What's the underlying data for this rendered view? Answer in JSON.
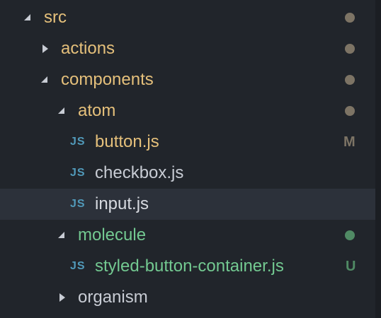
{
  "colors": {
    "background": "#21252b",
    "selected_row": "#2c313a",
    "modified": "#e5c07b",
    "untracked": "#73c991",
    "unchanged": "#c8ccd4",
    "dot_modified": "#7d7465",
    "dot_untracked": "#508a64",
    "js_icon": "#519aba"
  },
  "tree": {
    "items": [
      {
        "label": "src",
        "type": "folder",
        "state": "expanded",
        "status": "modified"
      },
      {
        "label": "actions",
        "type": "folder",
        "state": "collapsed",
        "status": "modified"
      },
      {
        "label": "components",
        "type": "folder",
        "state": "expanded",
        "status": "modified"
      },
      {
        "label": "atom",
        "type": "folder",
        "state": "expanded",
        "status": "modified"
      },
      {
        "label": "button.js",
        "type": "file",
        "icon": "JS",
        "status": "modified",
        "badge": "M"
      },
      {
        "label": "checkbox.js",
        "type": "file",
        "icon": "JS",
        "status": "none"
      },
      {
        "label": "input.js",
        "type": "file",
        "icon": "JS",
        "status": "none",
        "selected": true
      },
      {
        "label": "molecule",
        "type": "folder",
        "state": "expanded",
        "status": "untracked"
      },
      {
        "label": "styled-button-container.js",
        "type": "file",
        "icon": "JS",
        "status": "untracked",
        "badge": "U"
      },
      {
        "label": "organism",
        "type": "folder",
        "state": "collapsed",
        "status": "none"
      }
    ]
  }
}
